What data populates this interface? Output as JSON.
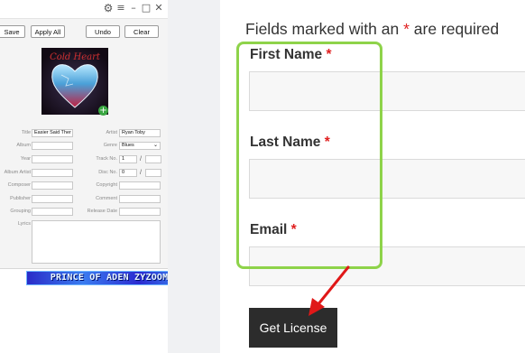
{
  "tag_editor": {
    "window_controls": [
      "gear-icon",
      "menu-icon",
      "minimize-icon",
      "maximize-icon",
      "close-icon"
    ],
    "buttons": {
      "save": "Save",
      "apply_all": "Apply All",
      "undo": "Undo",
      "clear": "Clear"
    },
    "album_art_text": "Cold Heart",
    "fields": {
      "title_label": "Title",
      "title_value": "Easier Said Ther",
      "artist_label": "Artist",
      "artist_value": "Ryan Toby",
      "album_label": "Album",
      "album_value": "",
      "genre_label": "Genre",
      "genre_value": "Blues",
      "year_label": "Year",
      "year_value": "",
      "track_label": "Track No.",
      "track_value": "1",
      "track_total": "",
      "album_artist_label": "Album Artist",
      "album_artist_value": "",
      "disc_label": "Disc No.",
      "disc_value": "0",
      "disc_total": "",
      "composer_label": "Composer",
      "composer_value": "",
      "copyright_label": "Copyright",
      "copyright_value": "",
      "publisher_label": "Publisher",
      "publisher_value": "",
      "comment_label": "Comment",
      "comment_value": "",
      "grouping_label": "Grouping",
      "grouping_value": "",
      "release_date_label": "Release Date",
      "release_date_value": "",
      "lyrics_label": "Lyrics",
      "lyrics_value": ""
    },
    "slash": "/"
  },
  "watermark": {
    "text": "PRINCE OF ADEN ZYZOOM.NET"
  },
  "form": {
    "required_note_pre": "Fields marked with an",
    "required_star": "*",
    "required_note_post": "are required",
    "first_name_label": "First Name",
    "last_name_label": "Last Name",
    "email_label": "Email",
    "star": "*",
    "submit_label": "Get License"
  },
  "colors": {
    "highlight": "#8ed34a",
    "arrow": "#e01818",
    "required": "#e02020",
    "button": "#2c2c2c"
  }
}
